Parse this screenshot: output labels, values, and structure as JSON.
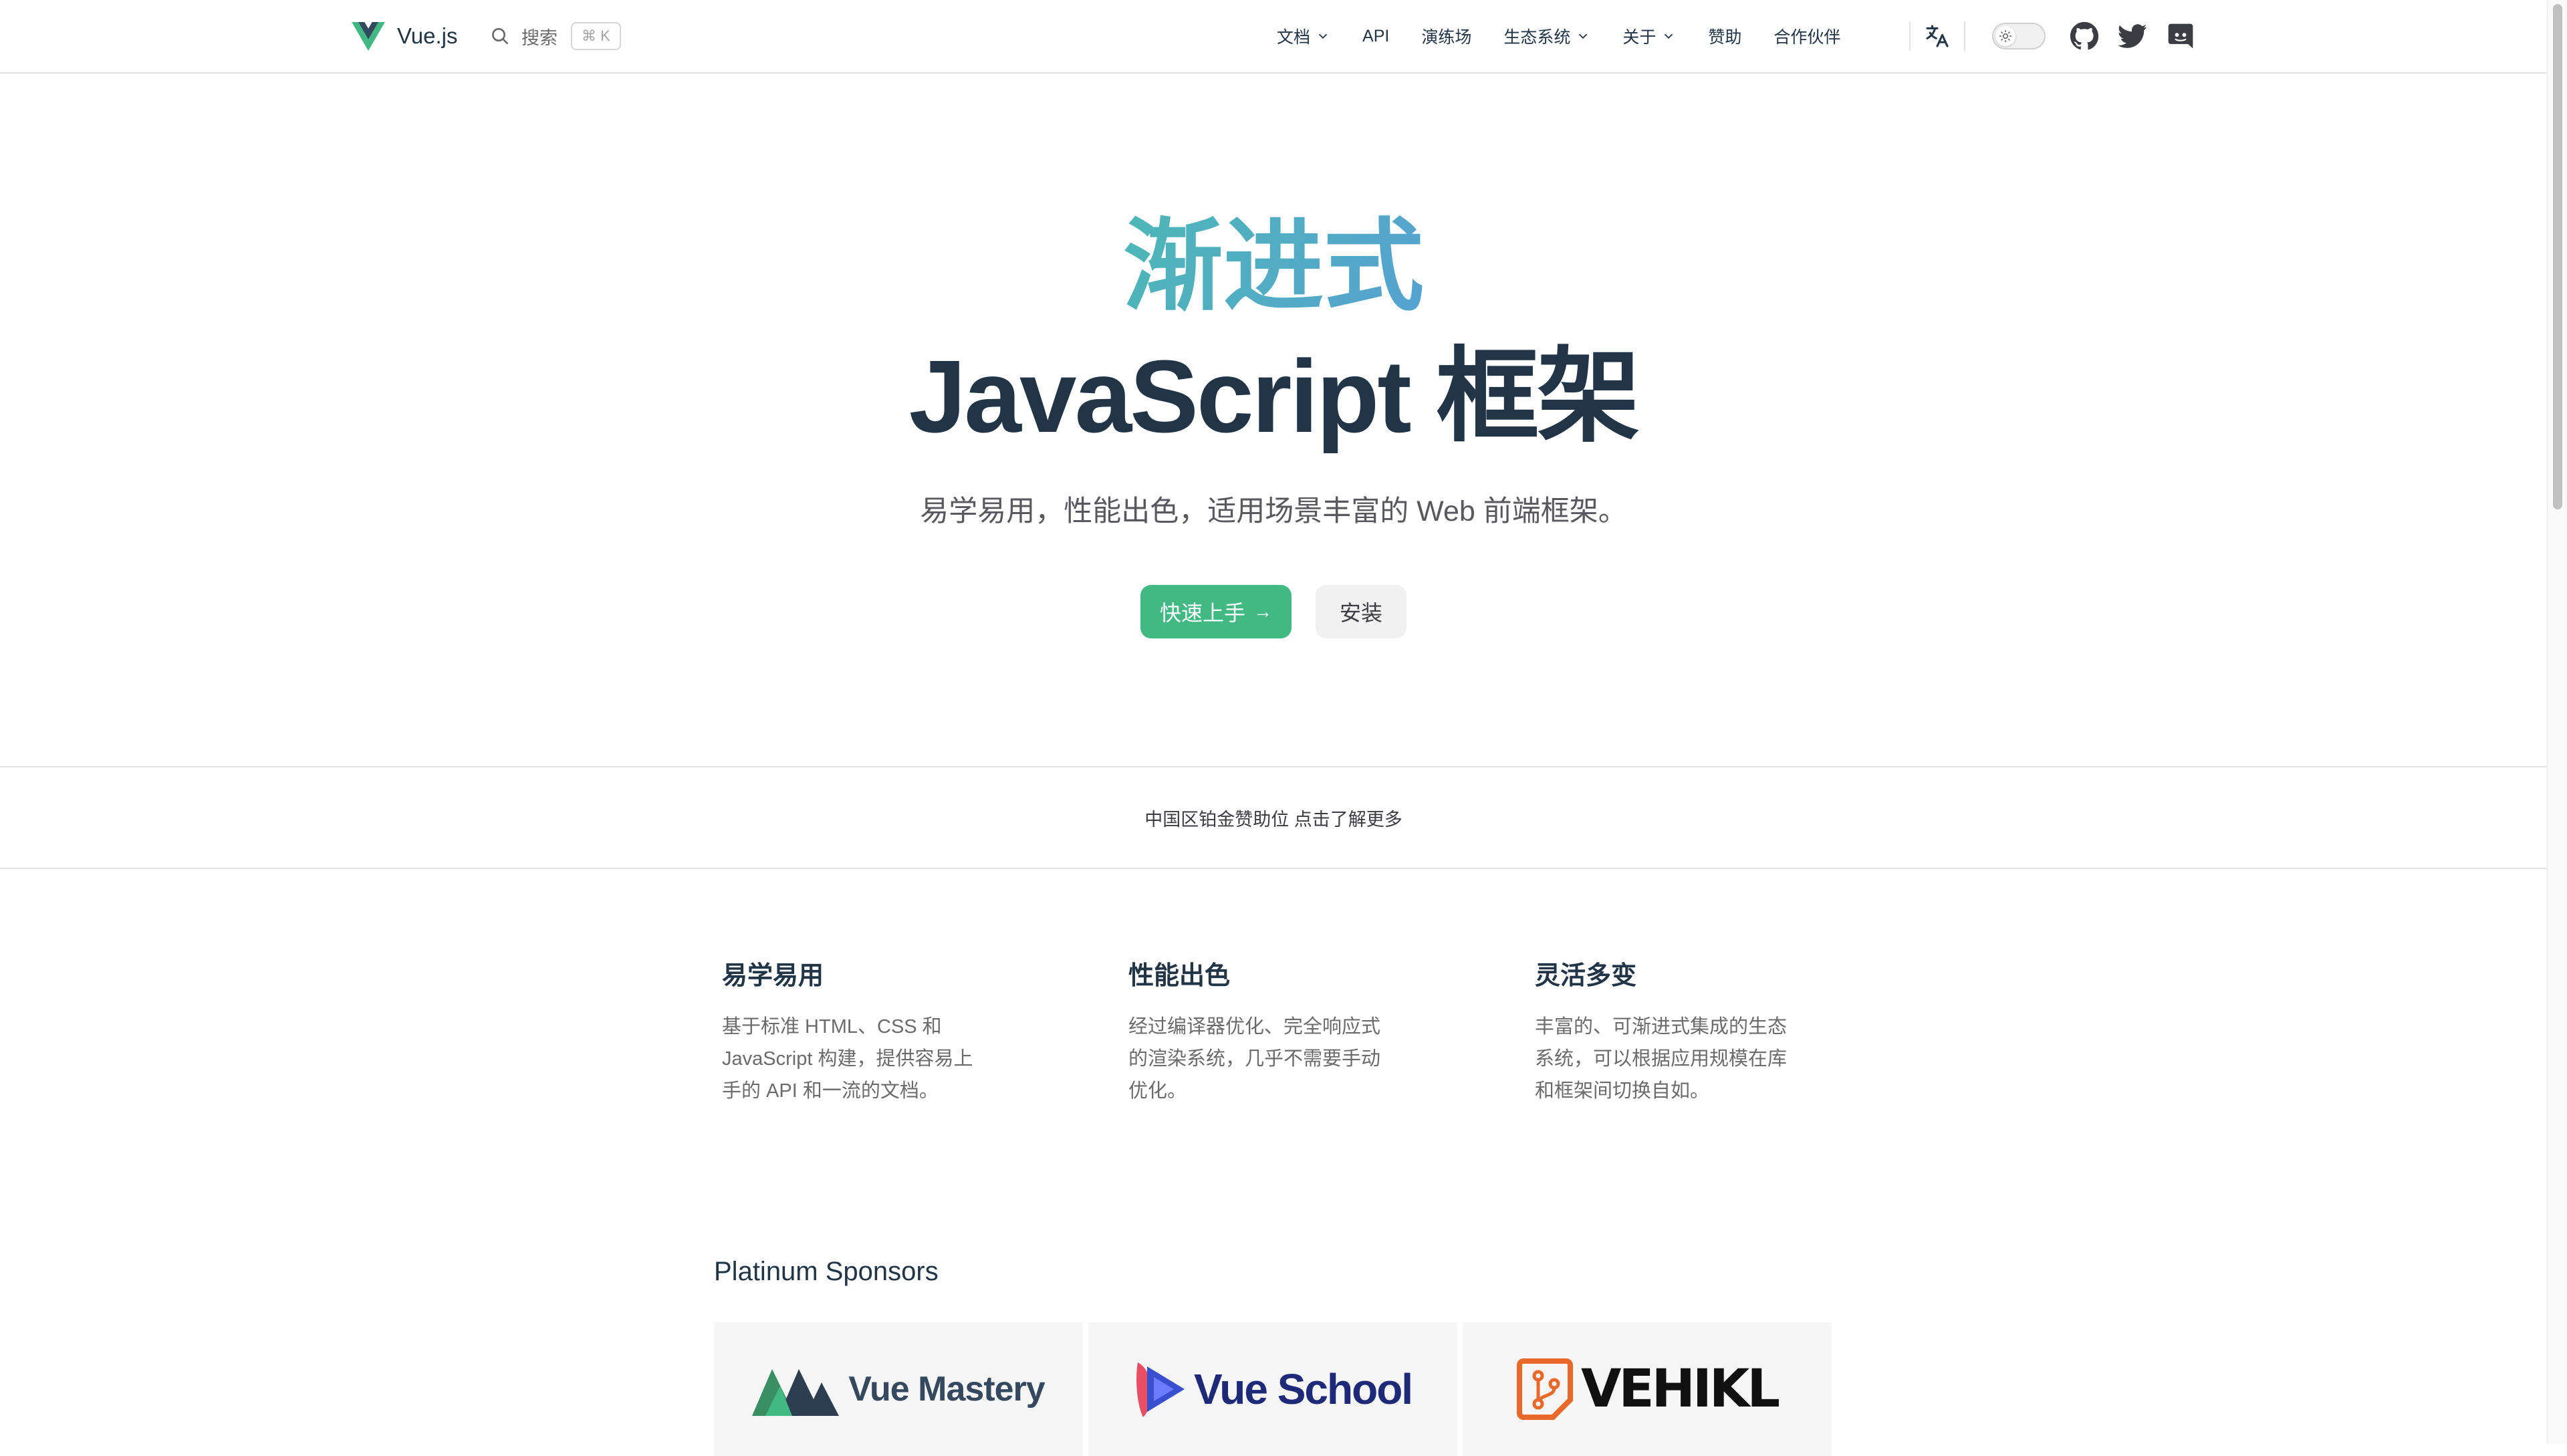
{
  "nav": {
    "brand": "Vue.js",
    "search_label": "搜索",
    "search_shortcut": "⌘ K",
    "menu": [
      {
        "label": "文档",
        "dropdown": true
      },
      {
        "label": "API",
        "dropdown": false
      },
      {
        "label": "演练场",
        "dropdown": false
      },
      {
        "label": "生态系统",
        "dropdown": true
      },
      {
        "label": "关于",
        "dropdown": true
      },
      {
        "label": "赞助",
        "dropdown": false
      },
      {
        "label": "合作伙伴",
        "dropdown": false
      }
    ],
    "icons": [
      "translate-icon",
      "theme-toggle",
      "github-icon",
      "twitter-icon",
      "discord-icon"
    ]
  },
  "hero": {
    "accent": "渐进式",
    "title": "JavaScript 框架",
    "subtitle": "易学易用，性能出色，适用场景丰富的 Web 前端框架。",
    "primary_button": "快速上手",
    "primary_arrow": "→",
    "secondary_button": "安装"
  },
  "sponsor_strip": {
    "text": "中国区铂金赞助位 点击了解更多"
  },
  "features": [
    {
      "title": "易学易用",
      "text": "基于标准 HTML、CSS 和 JavaScript 构建，提供容易上手的 API 和一流的文档。"
    },
    {
      "title": "性能出色",
      "text": "经过编译器优化、完全响应式的渲染系统，几乎不需要手动优化。"
    },
    {
      "title": "灵活多变",
      "text": "丰富的、可渐进式集成的生态系统，可以根据应用规模在库和框架间切换自如。"
    }
  ],
  "platinum": {
    "title": "Platinum Sponsors",
    "sponsors": [
      {
        "name": "Vue Mastery"
      },
      {
        "name": "Vue School"
      },
      {
        "name": "VEHIKL"
      }
    ]
  },
  "colors": {
    "brand_green": "#42b883",
    "text_dark": "#213547",
    "gradient_start": "#42d392",
    "gradient_end": "#647eff"
  }
}
